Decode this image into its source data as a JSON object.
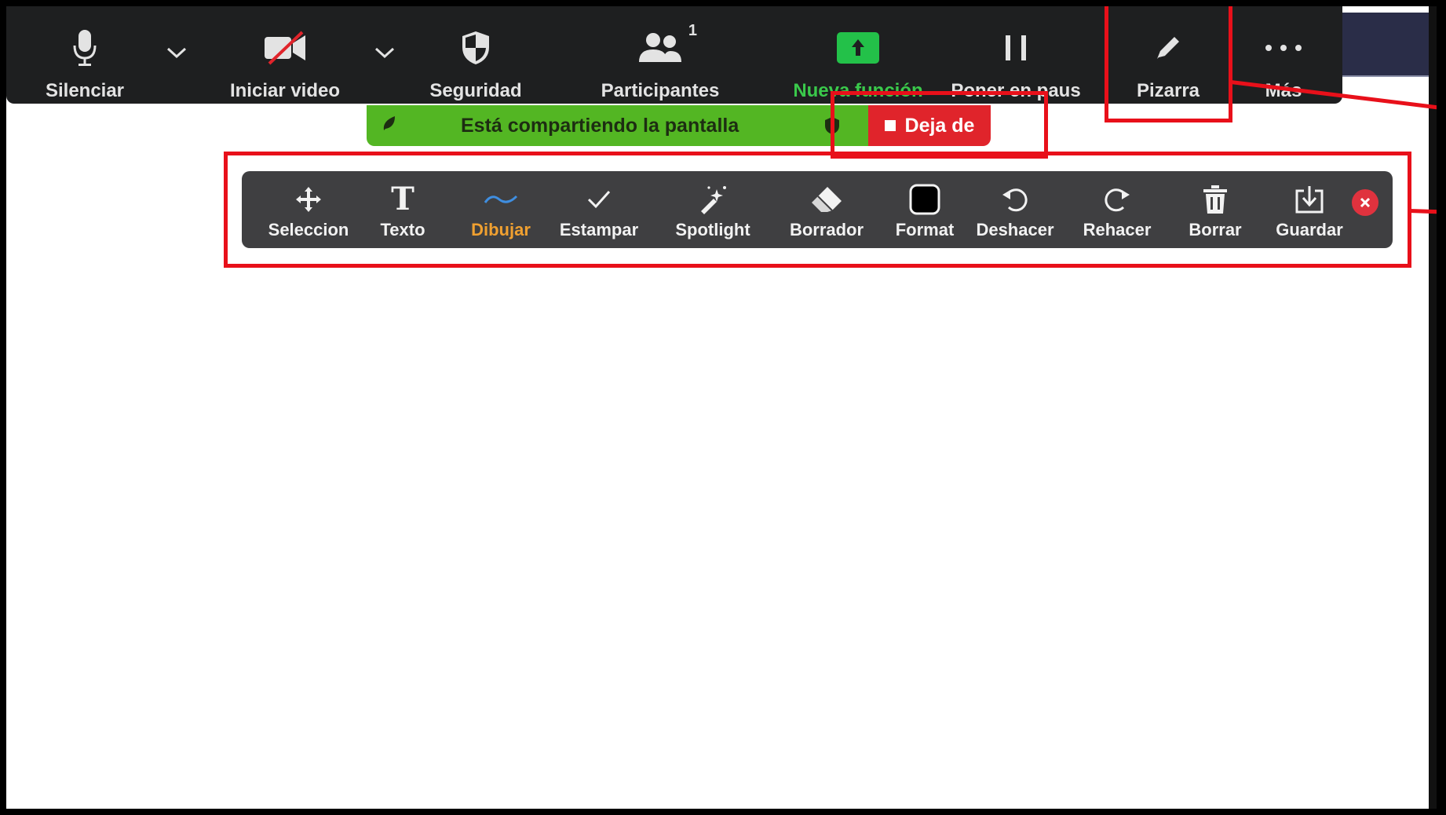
{
  "meeting_toolbar": {
    "items": [
      {
        "label": "Silenciar",
        "icon": "microphone-icon"
      },
      {
        "label": "Iniciar video",
        "icon": "video-off-icon"
      },
      {
        "label": "Seguridad",
        "icon": "shield-icon"
      },
      {
        "label": "Participantes",
        "icon": "participants-icon",
        "count": "1"
      },
      {
        "label": "Nueva función",
        "icon": "share-screen-icon"
      },
      {
        "label": "Poner en paus",
        "icon": "pause-icon"
      },
      {
        "label": "Pizarra",
        "icon": "pencil-icon"
      },
      {
        "label": "Más",
        "icon": "more-icon"
      }
    ]
  },
  "share_banner": {
    "text": "Está compartiendo la pantalla",
    "stop_label": "Deja de"
  },
  "annotation_toolbar": {
    "active": "Dibujar",
    "items": [
      {
        "label": "Seleccion",
        "icon": "move-icon"
      },
      {
        "label": "Texto",
        "icon": "text-icon"
      },
      {
        "label": "Dibujar",
        "icon": "draw-squiggle-icon"
      },
      {
        "label": "Estampar",
        "icon": "checkmark-icon"
      },
      {
        "label": "Spotlight",
        "icon": "magic-wand-icon"
      },
      {
        "label": "Borrador",
        "icon": "eraser-icon"
      },
      {
        "label": "Format",
        "icon": "color-square-icon"
      },
      {
        "label": "Deshacer",
        "icon": "undo-icon"
      },
      {
        "label": "Rehacer",
        "icon": "redo-icon"
      },
      {
        "label": "Borrar",
        "icon": "trash-icon"
      },
      {
        "label": "Guardar",
        "icon": "save-icon"
      }
    ]
  },
  "colors": {
    "highlight": "#e8101a",
    "share_green": "#53b623",
    "stop_red": "#e0242b",
    "active_orange": "#f0a030",
    "new_feature_green": "#3ac94b"
  }
}
